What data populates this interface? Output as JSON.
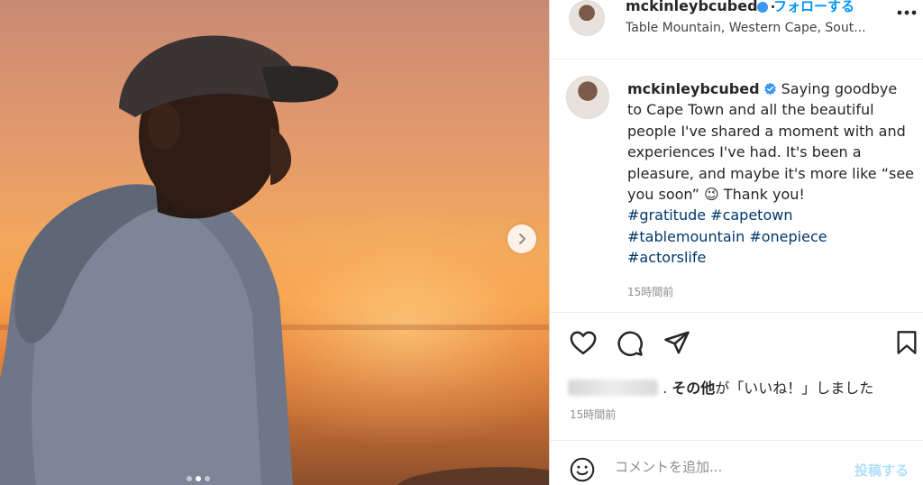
{
  "post": {
    "author": "mckinleybcubed",
    "follow_separator": "・",
    "follow_label": "フォローする",
    "location": "Table Mountain, Western Cape, Sout...",
    "caption_text": "Saying goodbye to Cape Town and all the beautiful people I've shared a moment with and experiences I've had. It's been a pleasure, and maybe it's more like “see you soon” 😉 Thank you!",
    "hashtags": [
      "#gratitude",
      "#capetown",
      "#tablemountain",
      "#onepiece",
      "#actorslife"
    ],
    "caption_time": "15時間前",
    "likes_others": "その他",
    "likes_suffix": "が「いいね！」しました",
    "likes_dot": ".",
    "post_time": "15時間前",
    "comment_placeholder": "コメントを追加...",
    "post_button": "投稿する"
  },
  "carousel": {
    "total": 3,
    "active_index": 1
  },
  "icons": {
    "next": "chevron-right-icon",
    "more": "more-options-icon",
    "verified": "verified-badge-icon",
    "like": "heart-icon",
    "comment": "comment-icon",
    "share": "paper-plane-icon",
    "save": "bookmark-icon",
    "emoji": "emoji-icon"
  },
  "colors": {
    "link_blue": "#0095f6",
    "hashtag": "#00376b",
    "verified": "#3897f0",
    "muted": "#8e8e8e"
  }
}
